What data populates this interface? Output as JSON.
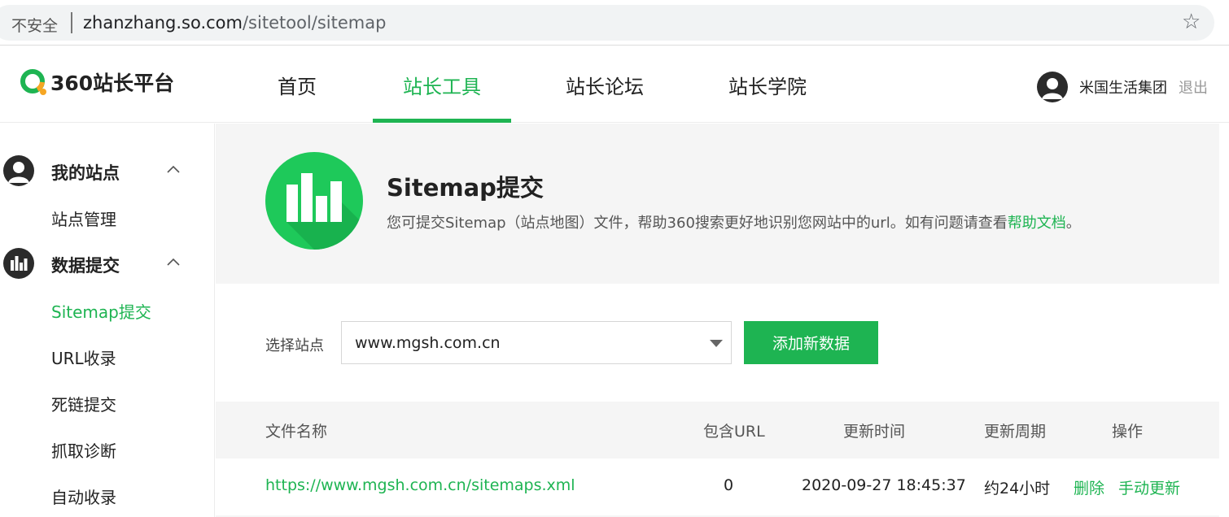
{
  "browser": {
    "security_label": "不安全",
    "url_host": "zhanzhang.so.com",
    "url_path": "/sitetool/sitemap",
    "bookmark_icon": "star-icon"
  },
  "header": {
    "logo_text": "360站长平台",
    "nav": [
      {
        "label": "首页",
        "active": false
      },
      {
        "label": "站长工具",
        "active": true
      },
      {
        "label": "站长论坛",
        "active": false
      },
      {
        "label": "站长学院",
        "active": false
      }
    ],
    "user_name": "米国生活集团",
    "logout": "退出"
  },
  "sidebar": {
    "groups": [
      {
        "label": "我的站点",
        "icon": "user-icon",
        "expanded": true,
        "items": [
          "站点管理"
        ]
      },
      {
        "label": "数据提交",
        "icon": "bar-chart-icon",
        "expanded": true,
        "items": [
          "Sitemap提交",
          "URL收录",
          "死链提交",
          "抓取诊断",
          "自动收录"
        ]
      }
    ],
    "active_item": "Sitemap提交"
  },
  "banner": {
    "title": "Sitemap提交",
    "desc": "您可提交Sitemap（站点地图）文件，帮助360搜索更好地识别您网站中的url。如有问题请查看",
    "help_link": "帮助文档",
    "desc_end": "。"
  },
  "form": {
    "select_label": "选择站点",
    "select_value": "www.mgsh.com.cn",
    "add_button": "添加新数据"
  },
  "table": {
    "headers": [
      "文件名称",
      "包含URL",
      "更新时间",
      "更新周期",
      "操作"
    ],
    "rows": [
      {
        "file": "https://www.mgsh.com.cn/sitemaps.xml",
        "url_count": "0",
        "updated": "2020-09-27 18:45:37",
        "cycle": "约24小时",
        "actions": [
          "删除",
          "手动更新"
        ]
      }
    ]
  },
  "colors": {
    "accent": "#1eb452",
    "icon_green": "#1ec95a",
    "dark": "#2b2b2b"
  }
}
